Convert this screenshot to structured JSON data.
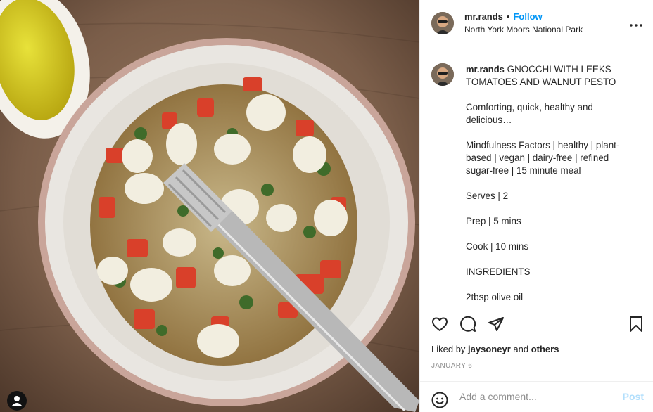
{
  "post": {
    "username": "mr.rands",
    "separator": "•",
    "follow_label": "Follow",
    "location": "North York Moors National Park",
    "more_icon": "more-horizontal-icon"
  },
  "caption": {
    "username": "mr.rands",
    "title": "GNOCCHI WITH LEEKS TOMATOES AND WALNUT PESTO",
    "paragraphs": [
      "Comforting, quick, healthy and delicious…",
      "Mindfulness Factors | healthy | plant-based | vegan | dairy-free | refined sugar-free | 15 minute meal",
      "Serves | 2",
      "Prep | 5 mins",
      "Cook | 10 mins",
      "INGREDIENTS",
      "2tbsp olive oil"
    ]
  },
  "actions": {
    "icons": [
      "heart-icon",
      "comment-icon",
      "share-icon",
      "bookmark-icon"
    ],
    "liked_by_prefix": "Liked by",
    "liked_by_user": "jaysoneyr",
    "liked_by_and": "and",
    "liked_by_others": "others",
    "date": "JANUARY 6"
  },
  "comment": {
    "emoji_icon": "emoji-icon",
    "placeholder": "Add a comment...",
    "post_label": "Post"
  },
  "photo": {
    "user_tag_icon": "user-tag-icon"
  },
  "colors": {
    "accent": "#0095f6",
    "post_disabled": "#b2dffc",
    "text": "#262626",
    "muted": "#8e8e8e"
  }
}
